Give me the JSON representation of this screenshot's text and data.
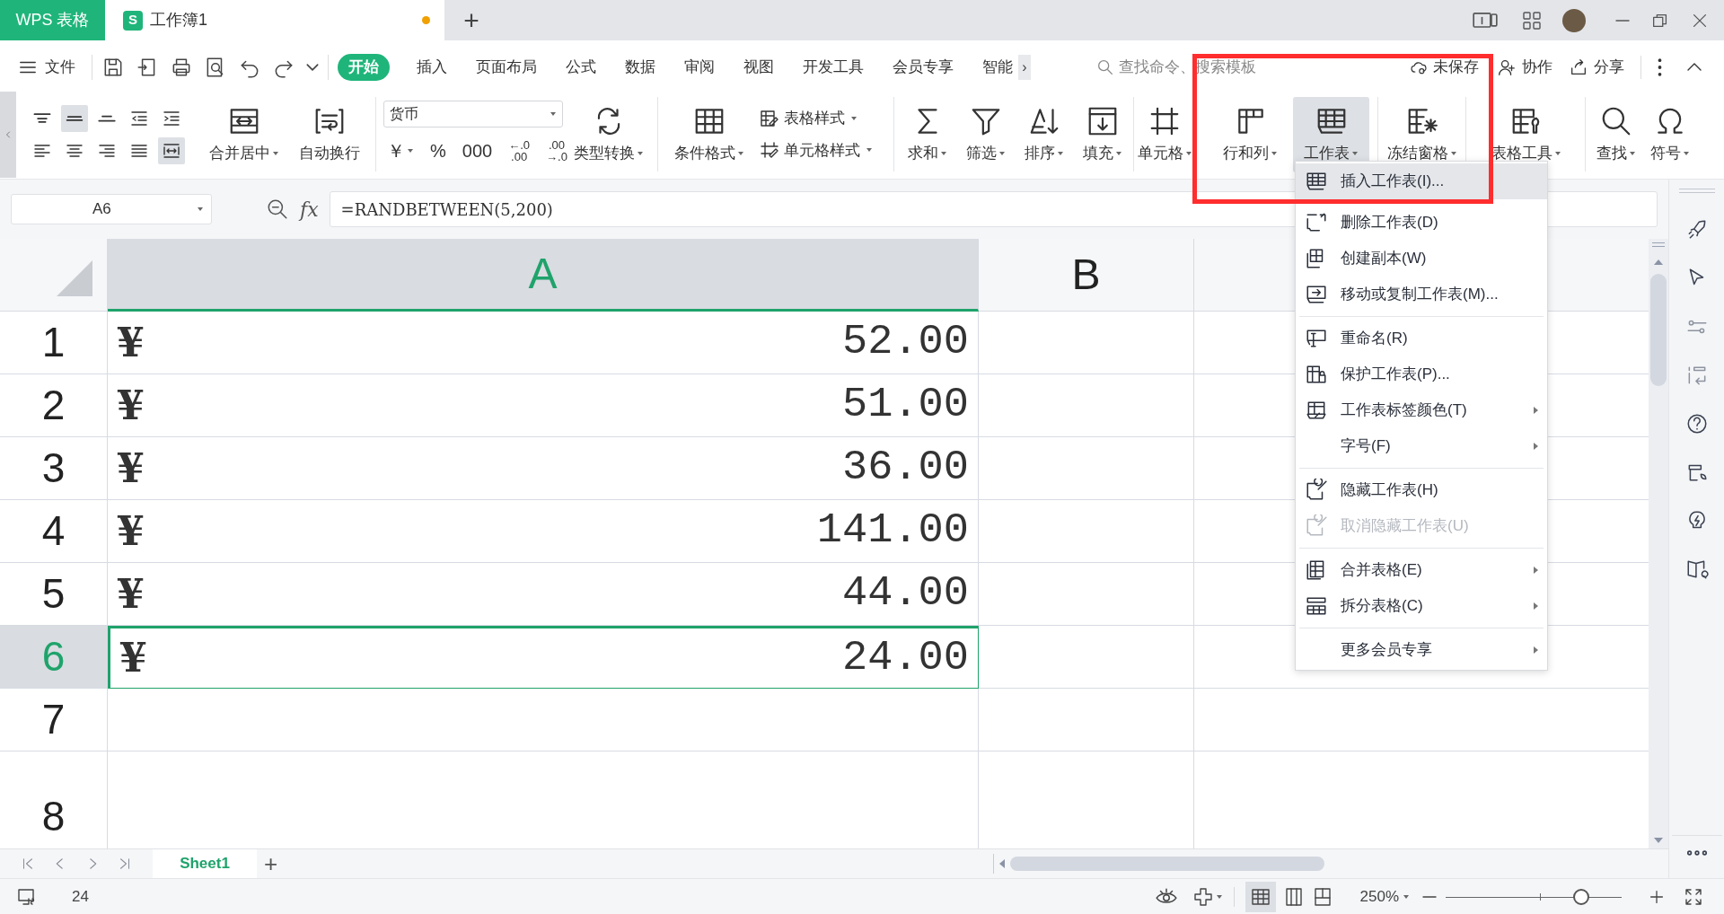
{
  "title_bar": {
    "app_tab": "WPS 表格",
    "document_tab": {
      "badge": "S",
      "title": "工作簿1",
      "unsaved": true
    },
    "new_tab": "+"
  },
  "menu_bar": {
    "file_menu": "文件",
    "tabs": [
      {
        "label": "开始",
        "selected": true
      },
      {
        "label": "插入",
        "selected": false
      },
      {
        "label": "页面布局",
        "selected": false
      },
      {
        "label": "公式",
        "selected": false
      },
      {
        "label": "数据",
        "selected": false
      },
      {
        "label": "审阅",
        "selected": false
      },
      {
        "label": "视图",
        "selected": false
      },
      {
        "label": "开发工具",
        "selected": false
      },
      {
        "label": "会员专享",
        "selected": false
      },
      {
        "label": "智能",
        "selected": false
      }
    ],
    "more_tabs": "›",
    "search": {
      "placeholder": "查找命令、搜索模板"
    },
    "save_status": "未保存",
    "collaborate": "协作",
    "share": "分享"
  },
  "ribbon": {
    "align_buttons": [
      {
        "selected": false
      },
      {
        "selected": true
      },
      {
        "selected": false
      },
      {
        "selected": false
      },
      {
        "selected": false
      },
      {
        "selected": false
      },
      {
        "selected": false
      },
      {
        "selected": false
      },
      {
        "selected": false
      },
      {
        "selected": true
      }
    ],
    "merge": {
      "label": "合并居中",
      "dropdown": true
    },
    "wrap": {
      "label": "自动换行",
      "dropdown": false
    },
    "number_format": {
      "value": "货币"
    },
    "number_buttons": [
      {
        "lines": [
          "￥"
        ],
        "dropdown": true
      },
      {
        "lines": [
          "%"
        ],
        "dropdown": false
      },
      {
        "lines": [
          "000"
        ],
        "dropdown": false
      },
      {
        "lines": [
          "←.0",
          ".00"
        ],
        "dropdown": false
      },
      {
        "lines": [
          ".00",
          "→.0"
        ],
        "dropdown": false
      }
    ],
    "convert": {
      "label": "类型转换",
      "dropdown": true
    },
    "conditional": {
      "label": "条件格式",
      "dropdown": true
    },
    "style_buttons": [
      {
        "label": "表格样式",
        "dropdown": true
      },
      {
        "label": "单元格样式",
        "dropdown": true
      }
    ],
    "tools": [
      {
        "label": "求和",
        "dropdown": true,
        "active": false
      },
      {
        "label": "筛选",
        "dropdown": true,
        "active": false
      },
      {
        "label": "排序",
        "dropdown": true,
        "active": false
      },
      {
        "label": "填充",
        "dropdown": true,
        "active": false
      },
      {
        "label": "单元格",
        "dropdown": true,
        "active": false
      },
      {
        "label": "行和列",
        "dropdown": true,
        "active": false
      },
      {
        "label": "工作表",
        "dropdown": true,
        "active": true
      },
      {
        "label": "冻结窗格",
        "dropdown": true,
        "active": false
      },
      {
        "label": "表格工具",
        "dropdown": true,
        "active": false
      },
      {
        "label": "查找",
        "dropdown": true,
        "active": false
      },
      {
        "label": "符号",
        "dropdown": true,
        "active": false
      }
    ]
  },
  "formula_bar": {
    "name_box": "A6",
    "fx": "fx",
    "formula": "=RANDBETWEEN(5,200)"
  },
  "sheet": {
    "columns": [
      {
        "label": "A",
        "selected": true
      },
      {
        "label": "B",
        "selected": false
      }
    ],
    "rows": [
      {
        "number": "1",
        "currency": "¥",
        "value": "52.00",
        "selected": false
      },
      {
        "number": "2",
        "currency": "¥",
        "value": "51.00",
        "selected": false
      },
      {
        "number": "3",
        "currency": "¥",
        "value": "36.00",
        "selected": false
      },
      {
        "number": "4",
        "currency": "¥",
        "value": "141.00",
        "selected": false
      },
      {
        "number": "5",
        "currency": "¥",
        "value": "44.00",
        "selected": false
      },
      {
        "number": "6",
        "currency": "¥",
        "value": "24.00",
        "selected": true
      },
      {
        "number": "7",
        "selected": false
      },
      {
        "number": "8",
        "selected": false
      }
    ]
  },
  "context_menu": {
    "items": [
      {
        "kind": "item",
        "label": "插入工作表(I)...",
        "selected": true,
        "disabled": false,
        "submenu": false
      },
      {
        "kind": "item",
        "label": "删除工作表(D)",
        "selected": false,
        "disabled": false,
        "submenu": false
      },
      {
        "kind": "item",
        "label": "创建副本(W)",
        "selected": false,
        "disabled": false,
        "submenu": false
      },
      {
        "kind": "item",
        "label": "移动或复制工作表(M)...",
        "selected": false,
        "disabled": false,
        "submenu": false
      },
      {
        "kind": "separator"
      },
      {
        "kind": "item",
        "label": "重命名(R)",
        "selected": false,
        "disabled": false,
        "submenu": false
      },
      {
        "kind": "item",
        "label": "保护工作表(P)...",
        "selected": false,
        "disabled": false,
        "submenu": false
      },
      {
        "kind": "item",
        "label": "工作表标签颜色(T)",
        "selected": false,
        "disabled": false,
        "submenu": true
      },
      {
        "kind": "item",
        "label": "字号(F)",
        "selected": false,
        "disabled": false,
        "submenu": true
      },
      {
        "kind": "separator"
      },
      {
        "kind": "item",
        "label": "隐藏工作表(H)",
        "selected": false,
        "disabled": false,
        "submenu": false
      },
      {
        "kind": "item",
        "label": "取消隐藏工作表(U)",
        "selected": false,
        "disabled": true,
        "submenu": false
      },
      {
        "kind": "separator"
      },
      {
        "kind": "item",
        "label": "合并表格(E)",
        "selected": false,
        "disabled": false,
        "submenu": true
      },
      {
        "kind": "item",
        "label": "拆分表格(C)",
        "selected": false,
        "disabled": false,
        "submenu": true
      },
      {
        "kind": "separator"
      },
      {
        "kind": "item",
        "label": "更多会员专享",
        "selected": false,
        "disabled": false,
        "submenu": true
      }
    ]
  },
  "annotation": {
    "kind": "frame"
  },
  "sheet_tabs": {
    "tabs": [
      {
        "label": "Sheet1",
        "selected": true
      }
    ],
    "add": "+"
  },
  "status_bar": {
    "value": "24",
    "zoom": "250%",
    "zoom_slider": {
      "level": 0.77
    }
  }
}
